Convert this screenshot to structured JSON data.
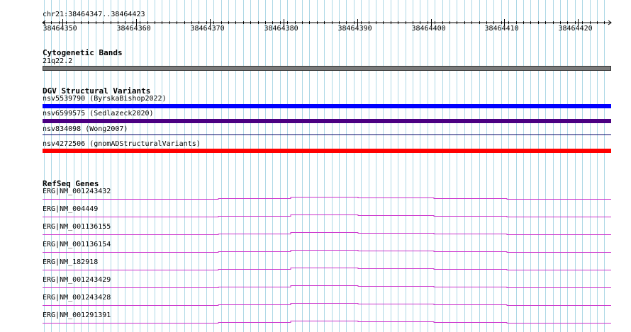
{
  "ruler": {
    "location": "chr21:38464347..38464423",
    "ticks": [
      "38464350",
      "38464360",
      "38464370",
      "38464380",
      "38464390",
      "38464400",
      "38464410",
      "38464420"
    ]
  },
  "tracks": {
    "cytoband": {
      "title": "Cytogenetic Bands",
      "label": "21q22.2",
      "color": "#7a7a7a"
    },
    "dgv": {
      "title": "DGV Structural Variants",
      "items": [
        {
          "label": "nsv5539790 (ByrskaBishop2022)",
          "color": "#0000ff"
        },
        {
          "label": "nsv6599575 (Sedlazeck2020)",
          "color": "#4b0082"
        },
        {
          "label": "nsv834098 (Wong2007)",
          "color": "#000066"
        },
        {
          "label": "nsv4272506 (gnomADStructuralVariants)",
          "color": "#ff0000"
        }
      ]
    },
    "refseq": {
      "title": "RefSeq Genes",
      "color": "#cc33cc",
      "items": [
        "ERG|NM_001243432",
        "ERG|NM_004449",
        "ERG|NM_001136155",
        "ERG|NM_001136154",
        "ERG|NM_182918",
        "ERG|NM_001243429",
        "ERG|NM_001243428",
        "ERG|NM_001291391"
      ]
    }
  },
  "colors": {
    "grid": "#add8e6"
  }
}
